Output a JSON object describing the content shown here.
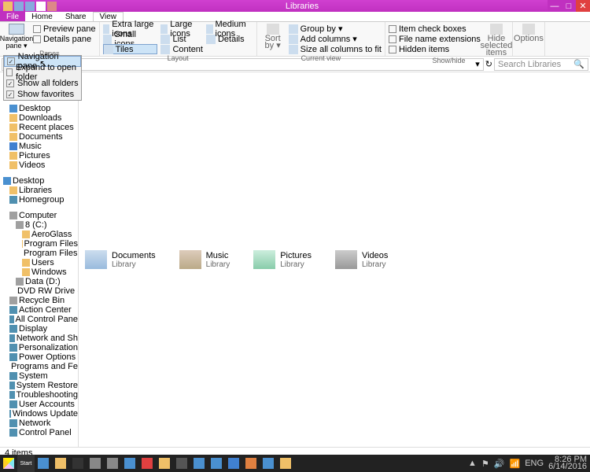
{
  "window": {
    "title": "Libraries"
  },
  "tabs": {
    "file": "File",
    "home": "Home",
    "share": "Share",
    "view": "View"
  },
  "ribbon": {
    "navpane": "Navigation pane ▾",
    "preview": "Preview pane",
    "details_pane": "Details pane",
    "panes_label": "Panes",
    "xl_icons": "Extra large icons",
    "l_icons": "Large icons",
    "m_icons": "Medium icons",
    "s_icons": "Small icons",
    "list": "List",
    "details": "Details",
    "tiles": "Tiles",
    "content": "Content",
    "layout_label": "Layout",
    "sortby": "Sort by ▾",
    "groupby": "Group by ▾",
    "addcols": "Add columns ▾",
    "sizecols": "Size all columns to fit",
    "curview_label": "Current view",
    "itemcheck": "Item check boxes",
    "fileext": "File name extensions",
    "hidden": "Hidden items",
    "hidesel": "Hide selected items",
    "options": "Options",
    "showhide_label": "Show/hide"
  },
  "dropdown": {
    "navpane": "Navigation pane",
    "expand": "Expand to open folder",
    "showall": "Show all folders",
    "showfav": "Show favorites"
  },
  "addr": {
    "refresh": "↻",
    "search_placeholder": "Search Libraries"
  },
  "tree": {
    "desktop": "Desktop",
    "downloads": "Downloads",
    "recent": "Recent places",
    "documents": "Documents",
    "music": "Music",
    "pictures": "Pictures",
    "videos": "Videos",
    "libraries": "Libraries",
    "homegroup": "Homegroup",
    "computer": "Computer",
    "c": "8 (C:)",
    "aeroglass": "AeroGlass",
    "pf": "Program Files",
    "pf86": "Program Files (",
    "users": "Users",
    "windows": "Windows",
    "d": "Data (D:)",
    "dvd": "DVD RW Drive (J:",
    "recycle": "Recycle Bin",
    "action": "Action Center",
    "allcp": "All Control Pane",
    "display": "Display",
    "netsh": "Network and Sh",
    "personal": "Personalization",
    "power": "Power Options",
    "progfeat": "Programs and Fe",
    "system": "System",
    "sysrest": "System Restore",
    "trouble": "Troubleshooting",
    "useracc": "User Accounts",
    "winupd": "Windows Update",
    "network": "Network",
    "cpanel": "Control Panel"
  },
  "libs": [
    {
      "name": "Documents",
      "sub": "Library"
    },
    {
      "name": "Music",
      "sub": "Library"
    },
    {
      "name": "Pictures",
      "sub": "Library"
    },
    {
      "name": "Videos",
      "sub": "Library"
    }
  ],
  "status": {
    "items": "4 items"
  },
  "taskbar": {
    "start": "Start",
    "lang": "ENG",
    "time": "8:26 PM",
    "date": "6/14/2016"
  }
}
